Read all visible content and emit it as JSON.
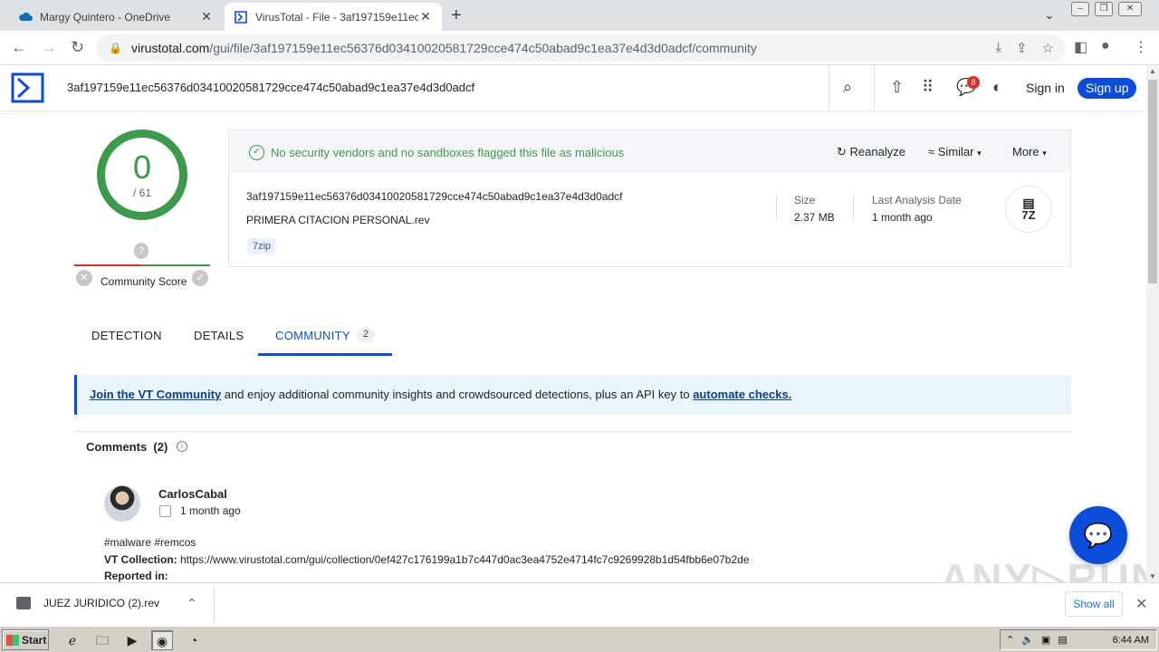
{
  "browser": {
    "tabs": [
      {
        "title": "Margy Quintero - OneDrive",
        "icon": "onedrive-cloud-icon"
      },
      {
        "title": "VirusTotal - File - 3af197159e11ec56",
        "icon": "virustotal-icon"
      }
    ],
    "url_host": "virustotal.com",
    "url_path": "/gui/file/3af197159e11ec56376d03410020581729cce474c50abad9c1ea37e4d3d0adcf/community"
  },
  "vt_header": {
    "search_value": "3af197159e11ec56376d03410020581729cce474c50abad9c1ea37e4d3d0adcf",
    "notification_count": "8",
    "signin": "Sign in",
    "signup": "Sign up"
  },
  "score": {
    "detections": "0",
    "total": "/ 61",
    "community_label": "Community Score",
    "community_question": "?"
  },
  "summary": {
    "status_message": "No security vendors and no sandboxes flagged this file as malicious",
    "reanalyze": "Reanalyze",
    "similar": "Similar",
    "more": "More",
    "hash": "3af197159e11ec56376d03410020581729cce474c50abad9c1ea37e4d3d0adcf",
    "filename": "PRIMERA CITACION PERSONAL.rev",
    "tag": "7zip",
    "size_label": "Size",
    "size_value": "2.37 MB",
    "date_label": "Last Analysis Date",
    "date_value": "1 month ago",
    "file_type_icon": "7Z"
  },
  "tabs": {
    "detection": "DETECTION",
    "details": "DETAILS",
    "community": "COMMUNITY",
    "community_count": "2"
  },
  "banner": {
    "link1": "Join the VT Community",
    "text": " and enjoy additional community insights and crowdsourced detections, plus an API key to ",
    "link2": "automate checks."
  },
  "comments": {
    "header": "Comments",
    "count": "(2)",
    "items": [
      {
        "author": "CarlosCabal",
        "time": "1 month ago",
        "line1": "#malware #remcos",
        "collection_label": "VT Collection:",
        "collection_url": " https://www.virustotal.com/gui/collection/0ef427c176199a1b7c447d0ac3ea4752e4714fc7c9269928b1d54fbb6e07b2de",
        "reported_label": "Reported in:"
      }
    ]
  },
  "download_bar": {
    "file": "JUEZ JURIDICO (2).rev",
    "show_all": "Show all"
  },
  "taskbar": {
    "start": "Start",
    "clock": "6:44 AM"
  },
  "colors": {
    "vt_blue": "#0b4dda",
    "clean_green": "#3b9b49",
    "malicious_red": "#d93025"
  }
}
